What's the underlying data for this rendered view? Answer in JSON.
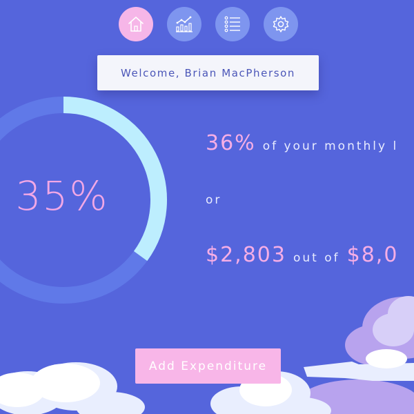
{
  "nav": {
    "items": [
      {
        "icon": "home-icon",
        "active": true
      },
      {
        "icon": "chart-icon",
        "active": false
      },
      {
        "icon": "list-icon",
        "active": false
      },
      {
        "icon": "gear-icon",
        "active": false
      }
    ]
  },
  "welcome": {
    "text": "Welcome, Brian MacPherson"
  },
  "gauge": {
    "label": "35%",
    "progress": 0.35
  },
  "summary": {
    "percent": "36%",
    "percent_suffix": "of your monthly l",
    "or": "or",
    "spent": "$2,803",
    "out_of": "out of",
    "limit": "$8,0"
  },
  "actions": {
    "add_label": "Add Expenditure"
  },
  "colors": {
    "background": "#5565dc",
    "accent_pink": "#f6aee6",
    "track": "#6079e8",
    "progress": "#bdeefe"
  }
}
